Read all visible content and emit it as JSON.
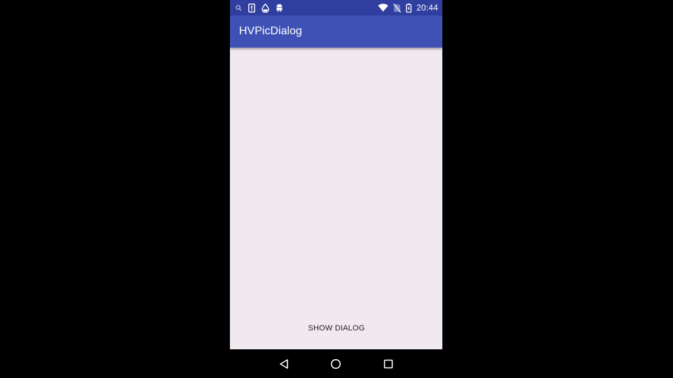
{
  "status_bar": {
    "time": "20:44",
    "left_icons": [
      "search-icon",
      "sim-card-icon",
      "drop-icon",
      "android-icon"
    ],
    "right_icons": [
      "wifi-icon",
      "no-sim-icon",
      "battery-charging-icon"
    ]
  },
  "app_bar": {
    "title": "HVPicDialog"
  },
  "main": {
    "show_dialog_label": "SHOW DIALOG"
  },
  "nav_bar": {
    "buttons": [
      "back-icon",
      "home-icon",
      "recents-icon"
    ]
  },
  "colors": {
    "status_bar": "#303f9f",
    "app_bar": "#3f51b5",
    "content_background": "#f0e9f0",
    "outer_background": "#000000"
  }
}
